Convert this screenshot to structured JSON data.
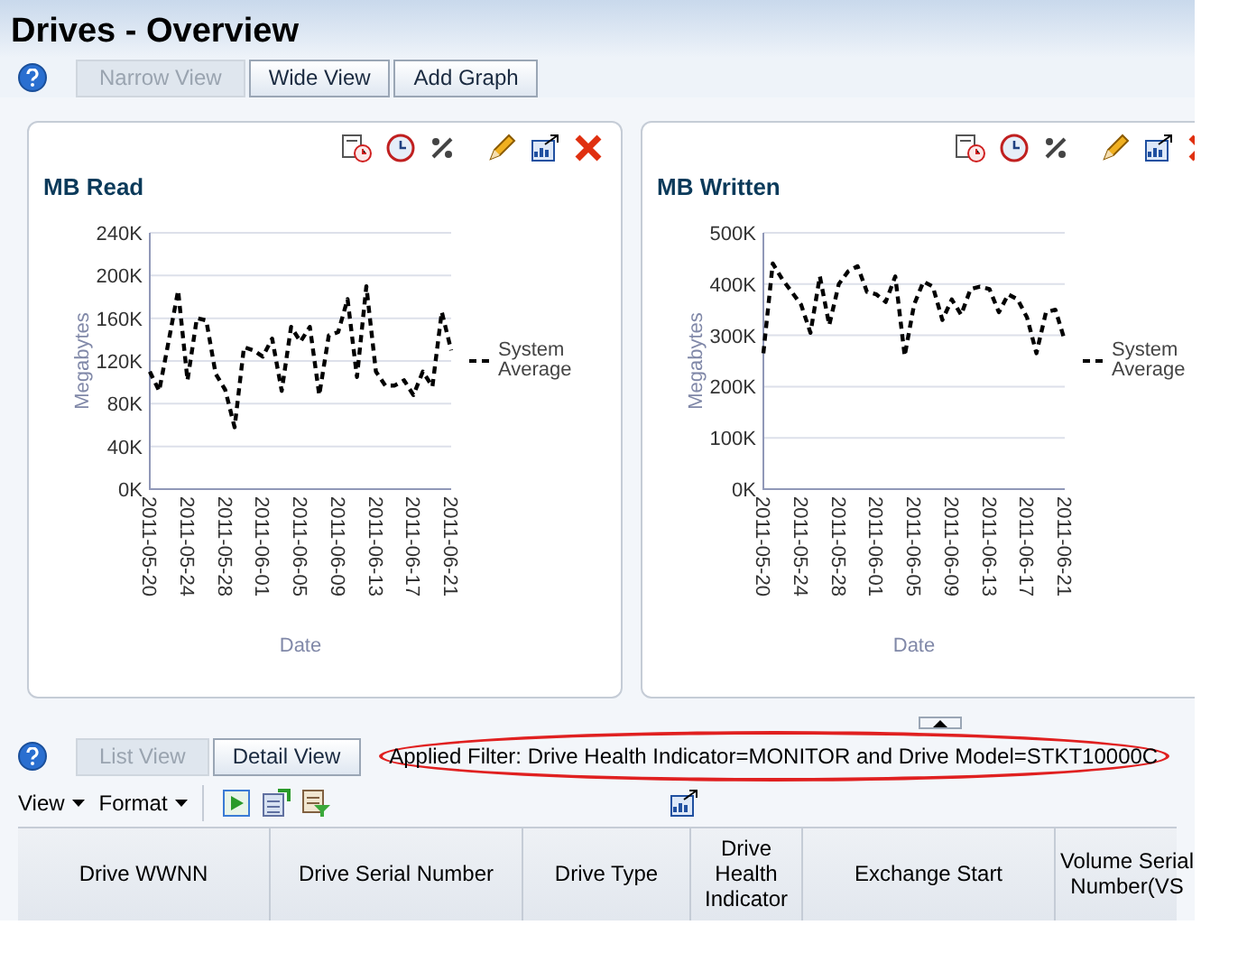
{
  "page_title": "Drives - Overview",
  "view_buttons": [
    {
      "label": "Narrow View",
      "disabled": true
    },
    {
      "label": "Wide View",
      "disabled": false
    },
    {
      "label": "Add Graph",
      "disabled": false
    }
  ],
  "charts": [
    {
      "title": "MB Read",
      "chart_data": {
        "type": "line",
        "xlabel": "Date",
        "ylabel": "Megabytes",
        "grid": true,
        "categories": [
          "2011-05-20",
          null,
          null,
          null,
          "2011-05-24",
          null,
          null,
          null,
          "2011-05-28",
          null,
          null,
          null,
          "2011-06-01",
          null,
          null,
          null,
          "2011-06-05",
          null,
          null,
          null,
          "2011-06-09",
          null,
          null,
          null,
          "2011-06-13",
          null,
          null,
          null,
          "2011-06-17",
          null,
          null,
          null,
          "2011-06-21"
        ],
        "series": [
          {
            "name": "System Average",
            "color": "#000000",
            "line_style": "dashed",
            "values": [
              110,
              92,
              138,
              186,
              102,
              160,
              158,
              108,
              93,
              58,
              133,
              130,
              124,
              141,
              92,
              152,
              138,
              152,
              88,
              144,
              147,
              178,
              105,
              190,
              110,
              97,
              97,
              102,
              88,
              110,
              96,
              166,
              130
            ]
          }
        ],
        "ylim": [
          0,
          240
        ],
        "yticks": [
          {
            "value": 0,
            "label": "0K"
          },
          {
            "value": 40,
            "label": "40K"
          },
          {
            "value": 80,
            "label": "80K"
          },
          {
            "value": 120,
            "label": "120K"
          },
          {
            "value": 160,
            "label": "160K"
          },
          {
            "value": 200,
            "label": "200K"
          },
          {
            "value": 240,
            "label": "240K"
          }
        ]
      }
    },
    {
      "title": "MB Written",
      "chart_data": {
        "type": "line",
        "xlabel": "Date",
        "ylabel": "Megabytes",
        "grid": true,
        "categories": [
          "2011-05-20",
          null,
          null,
          null,
          "2011-05-24",
          null,
          null,
          null,
          "2011-05-28",
          null,
          null,
          null,
          "2011-06-01",
          null,
          null,
          null,
          "2011-06-05",
          null,
          null,
          null,
          "2011-06-09",
          null,
          null,
          null,
          "2011-06-13",
          null,
          null,
          null,
          "2011-06-17",
          null,
          null,
          null,
          "2011-06-21"
        ],
        "series": [
          {
            "name": "System Average",
            "color": "#000000",
            "line_style": "dashed",
            "values": [
              265,
              440,
              410,
              385,
              360,
              305,
              415,
              320,
              400,
              425,
              435,
              385,
              380,
              365,
              415,
              260,
              360,
              405,
              395,
              330,
              370,
              340,
              390,
              395,
              390,
              345,
              380,
              370,
              335,
              265,
              345,
              350,
              290
            ]
          }
        ],
        "ylim": [
          0,
          500
        ],
        "yticks": [
          {
            "value": 0,
            "label": "0K"
          },
          {
            "value": 100,
            "label": "100K"
          },
          {
            "value": 200,
            "label": "200K"
          },
          {
            "value": 300,
            "label": "300K"
          },
          {
            "value": 400,
            "label": "400K"
          },
          {
            "value": 500,
            "label": "500K"
          }
        ]
      }
    }
  ],
  "list_buttons": [
    {
      "label": "List View",
      "disabled": true
    },
    {
      "label": "Detail View",
      "disabled": false
    }
  ],
  "applied_filter": "Applied Filter: Drive Health Indicator=MONITOR and Drive Model=STKT10000C",
  "menus": [
    {
      "label": "View"
    },
    {
      "label": "Format"
    }
  ],
  "table": {
    "columns": [
      "Drive WWNN",
      "Drive Serial Number",
      "Drive Type",
      "Drive Health Indicator",
      "Exchange Start",
      "Volume Serial Number(VS"
    ]
  }
}
